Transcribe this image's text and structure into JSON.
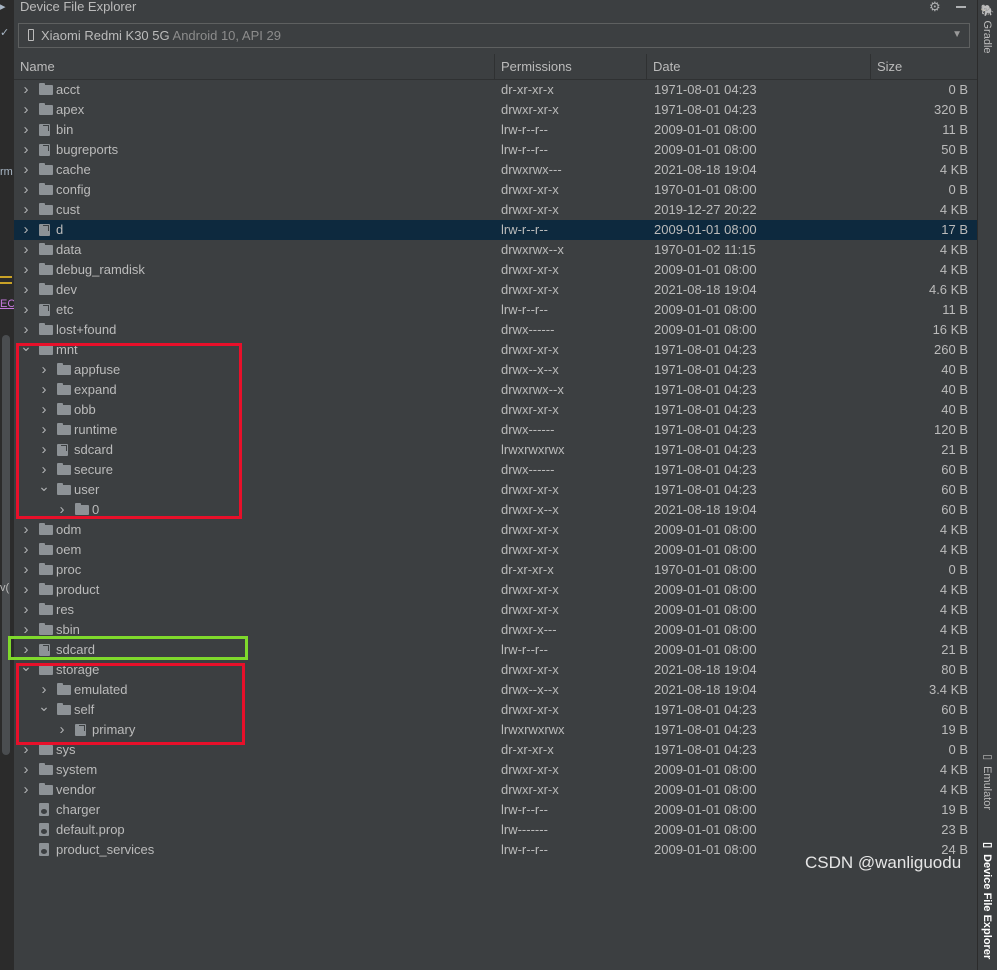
{
  "window": {
    "title": "Device File Explorer"
  },
  "device": {
    "name": "Xiaomi Redmi K30 5G",
    "detail": "Android 10, API 29"
  },
  "columns": {
    "name": "Name",
    "permissions": "Permissions",
    "date": "Date",
    "size": "Size"
  },
  "rows": [
    {
      "name": "acct",
      "perm": "dr-xr-xr-x",
      "date": "1971-08-01 04:23",
      "size": "0 B",
      "type": "folder",
      "depth": 0,
      "state": "collapsed"
    },
    {
      "name": "apex",
      "perm": "drwxr-xr-x",
      "date": "1971-08-01 04:23",
      "size": "320 B",
      "type": "folder",
      "depth": 0,
      "state": "collapsed"
    },
    {
      "name": "bin",
      "perm": "lrw-r--r--",
      "date": "2009-01-01 08:00",
      "size": "11 B",
      "type": "link",
      "depth": 0,
      "state": "collapsed"
    },
    {
      "name": "bugreports",
      "perm": "lrw-r--r--",
      "date": "2009-01-01 08:00",
      "size": "50 B",
      "type": "link",
      "depth": 0,
      "state": "collapsed"
    },
    {
      "name": "cache",
      "perm": "drwxrwx---",
      "date": "2021-08-18 19:04",
      "size": "4 KB",
      "type": "folder",
      "depth": 0,
      "state": "collapsed"
    },
    {
      "name": "config",
      "perm": "drwxr-xr-x",
      "date": "1970-01-01 08:00",
      "size": "0 B",
      "type": "folder",
      "depth": 0,
      "state": "collapsed"
    },
    {
      "name": "cust",
      "perm": "drwxr-xr-x",
      "date": "2019-12-27 20:22",
      "size": "4 KB",
      "type": "folder",
      "depth": 0,
      "state": "collapsed"
    },
    {
      "name": "d",
      "perm": "lrw-r--r--",
      "date": "2009-01-01 08:00",
      "size": "17 B",
      "type": "link",
      "depth": 0,
      "state": "collapsed",
      "selected": true
    },
    {
      "name": "data",
      "perm": "drwxrwx--x",
      "date": "1970-01-02 11:15",
      "size": "4 KB",
      "type": "folder",
      "depth": 0,
      "state": "collapsed"
    },
    {
      "name": "debug_ramdisk",
      "perm": "drwxr-xr-x",
      "date": "2009-01-01 08:00",
      "size": "4 KB",
      "type": "folder",
      "depth": 0,
      "state": "collapsed"
    },
    {
      "name": "dev",
      "perm": "drwxr-xr-x",
      "date": "2021-08-18 19:04",
      "size": "4.6 KB",
      "type": "folder",
      "depth": 0,
      "state": "collapsed"
    },
    {
      "name": "etc",
      "perm": "lrw-r--r--",
      "date": "2009-01-01 08:00",
      "size": "11 B",
      "type": "link",
      "depth": 0,
      "state": "collapsed"
    },
    {
      "name": "lost+found",
      "perm": "drwx------",
      "date": "2009-01-01 08:00",
      "size": "16 KB",
      "type": "folder",
      "depth": 0,
      "state": "collapsed"
    },
    {
      "name": "mnt",
      "perm": "drwxr-xr-x",
      "date": "1971-08-01 04:23",
      "size": "260 B",
      "type": "folder",
      "depth": 0,
      "state": "expanded"
    },
    {
      "name": "appfuse",
      "perm": "drwx--x--x",
      "date": "1971-08-01 04:23",
      "size": "40 B",
      "type": "folder",
      "depth": 1,
      "state": "collapsed"
    },
    {
      "name": "expand",
      "perm": "drwxrwx--x",
      "date": "1971-08-01 04:23",
      "size": "40 B",
      "type": "folder",
      "depth": 1,
      "state": "collapsed"
    },
    {
      "name": "obb",
      "perm": "drwxr-xr-x",
      "date": "1971-08-01 04:23",
      "size": "40 B",
      "type": "folder",
      "depth": 1,
      "state": "collapsed"
    },
    {
      "name": "runtime",
      "perm": "drwx------",
      "date": "1971-08-01 04:23",
      "size": "120 B",
      "type": "folder",
      "depth": 1,
      "state": "collapsed"
    },
    {
      "name": "sdcard",
      "perm": "lrwxrwxrwx",
      "date": "1971-08-01 04:23",
      "size": "21 B",
      "type": "link",
      "depth": 1,
      "state": "collapsed"
    },
    {
      "name": "secure",
      "perm": "drwx------",
      "date": "1971-08-01 04:23",
      "size": "60 B",
      "type": "folder",
      "depth": 1,
      "state": "collapsed"
    },
    {
      "name": "user",
      "perm": "drwxr-xr-x",
      "date": "1971-08-01 04:23",
      "size": "60 B",
      "type": "folder",
      "depth": 1,
      "state": "expanded"
    },
    {
      "name": "0",
      "perm": "drwxr-x--x",
      "date": "2021-08-18 19:04",
      "size": "60 B",
      "type": "folder",
      "depth": 2,
      "state": "collapsed"
    },
    {
      "name": "odm",
      "perm": "drwxr-xr-x",
      "date": "2009-01-01 08:00",
      "size": "4 KB",
      "type": "folder",
      "depth": 0,
      "state": "collapsed"
    },
    {
      "name": "oem",
      "perm": "drwxr-xr-x",
      "date": "2009-01-01 08:00",
      "size": "4 KB",
      "type": "folder",
      "depth": 0,
      "state": "collapsed"
    },
    {
      "name": "proc",
      "perm": "dr-xr-xr-x",
      "date": "1970-01-01 08:00",
      "size": "0 B",
      "type": "folder",
      "depth": 0,
      "state": "collapsed"
    },
    {
      "name": "product",
      "perm": "drwxr-xr-x",
      "date": "2009-01-01 08:00",
      "size": "4 KB",
      "type": "folder",
      "depth": 0,
      "state": "collapsed"
    },
    {
      "name": "res",
      "perm": "drwxr-xr-x",
      "date": "2009-01-01 08:00",
      "size": "4 KB",
      "type": "folder",
      "depth": 0,
      "state": "collapsed"
    },
    {
      "name": "sbin",
      "perm": "drwxr-x---",
      "date": "2009-01-01 08:00",
      "size": "4 KB",
      "type": "folder",
      "depth": 0,
      "state": "collapsed"
    },
    {
      "name": "sdcard",
      "perm": "lrw-r--r--",
      "date": "2009-01-01 08:00",
      "size": "21 B",
      "type": "link",
      "depth": 0,
      "state": "collapsed"
    },
    {
      "name": "storage",
      "perm": "drwxr-xr-x",
      "date": "2021-08-18 19:04",
      "size": "80 B",
      "type": "folder",
      "depth": 0,
      "state": "expanded"
    },
    {
      "name": "emulated",
      "perm": "drwx--x--x",
      "date": "2021-08-18 19:04",
      "size": "3.4 KB",
      "type": "folder",
      "depth": 1,
      "state": "collapsed"
    },
    {
      "name": "self",
      "perm": "drwxr-xr-x",
      "date": "1971-08-01 04:23",
      "size": "60 B",
      "type": "folder",
      "depth": 1,
      "state": "expanded"
    },
    {
      "name": "primary",
      "perm": "lrwxrwxrwx",
      "date": "1971-08-01 04:23",
      "size": "19 B",
      "type": "link",
      "depth": 2,
      "state": "collapsed"
    },
    {
      "name": "sys",
      "perm": "dr-xr-xr-x",
      "date": "1971-08-01 04:23",
      "size": "0 B",
      "type": "folder",
      "depth": 0,
      "state": "collapsed"
    },
    {
      "name": "system",
      "perm": "drwxr-xr-x",
      "date": "2009-01-01 08:00",
      "size": "4 KB",
      "type": "folder",
      "depth": 0,
      "state": "collapsed"
    },
    {
      "name": "vendor",
      "perm": "drwxr-xr-x",
      "date": "2009-01-01 08:00",
      "size": "4 KB",
      "type": "folder",
      "depth": 0,
      "state": "collapsed"
    },
    {
      "name": "charger",
      "perm": "lrw-r--r--",
      "date": "2009-01-01 08:00",
      "size": "19 B",
      "type": "file",
      "depth": 0,
      "state": "none"
    },
    {
      "name": "default.prop",
      "perm": "lrw-------",
      "date": "2009-01-01 08:00",
      "size": "23 B",
      "type": "file",
      "depth": 0,
      "state": "none"
    },
    {
      "name": "product_services",
      "perm": "lrw-r--r--",
      "date": "2009-01-01 08:00",
      "size": "24 B",
      "type": "file",
      "depth": 0,
      "state": "none"
    }
  ],
  "right_sidebar": {
    "gradle": "Gradle",
    "emulator": "Emulator",
    "explorer": "Device File Explorer"
  },
  "left_strip": {
    "m1": "rm",
    "m2": "EC",
    "m3": "v("
  },
  "watermark": "CSDN @wanliguodu",
  "colors": {
    "background": "#3c3f41",
    "selected_row": "#0d293e",
    "annotation_red": "#e8102a",
    "annotation_green": "#7fd92c"
  }
}
